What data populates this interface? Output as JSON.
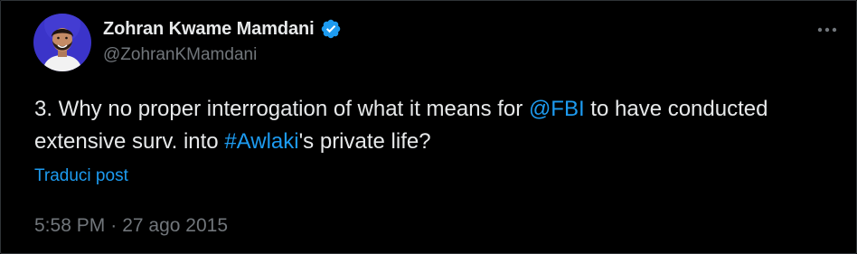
{
  "author": {
    "display_name": "Zohran Kwame Mamdani",
    "handle": "@ZohranKMamdani",
    "verified": true
  },
  "tweet": {
    "text_part1": "3. Why no proper interrogation of what it means for ",
    "mention": "@FBI",
    "text_part2": " to have conducted extensive surv. into ",
    "hashtag": "#Awlaki",
    "text_part3": "'s private life?"
  },
  "translate_label": "Traduci post",
  "meta": {
    "time": "5:58 PM",
    "separator": "·",
    "date": "27 ago 2015"
  },
  "icons": {
    "avatar": "profile-photo",
    "verified": "verified-badge-icon",
    "more": "more-options-icon"
  },
  "colors": {
    "background": "#000000",
    "text": "#e7e9ea",
    "secondary_text": "#71767b",
    "link": "#1d9bf0",
    "verified_badge": "#1d9bf0"
  }
}
